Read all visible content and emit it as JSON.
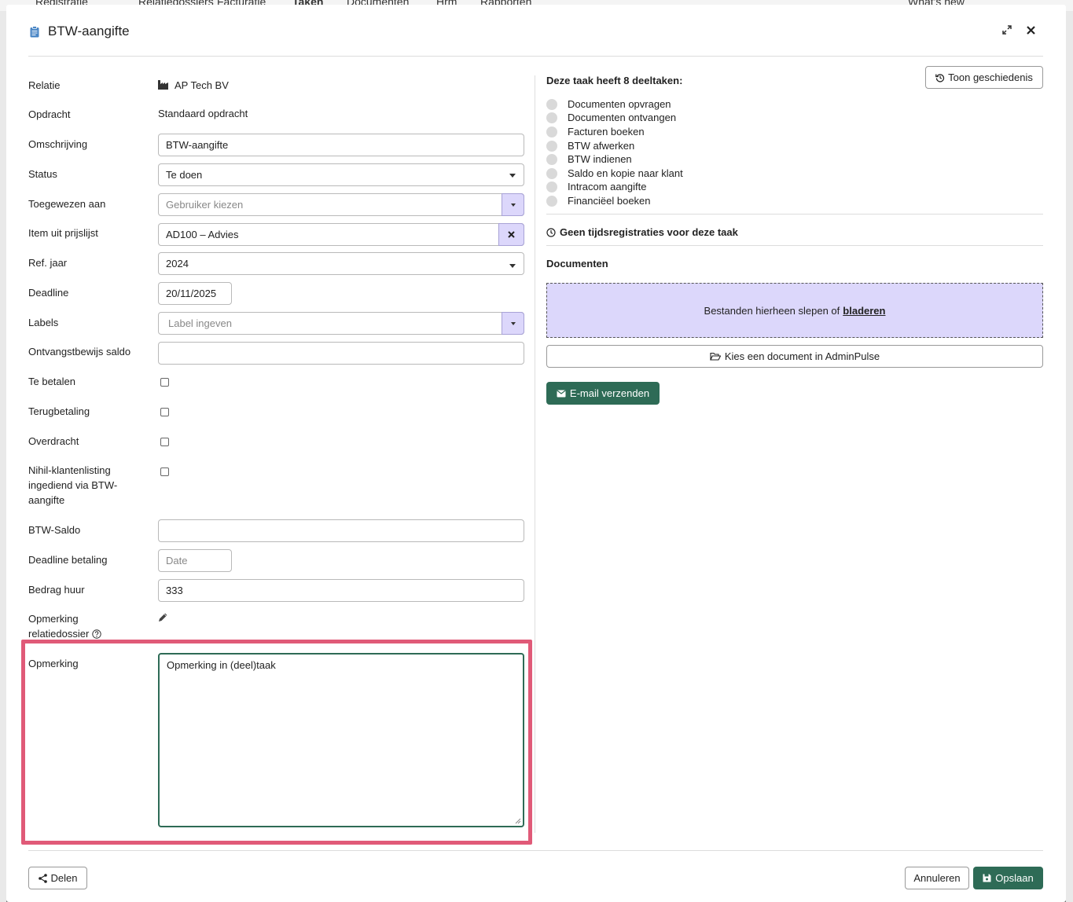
{
  "background_nav": {
    "items": [
      "Registratie",
      "Relatiedossiers",
      "Facturatie",
      "Taken",
      "Documenten",
      "Hrm",
      "Rapporten",
      "What's new"
    ]
  },
  "modal": {
    "title": "BTW-aangifte",
    "title_icon": "clipboard-icon",
    "expand_icon": "expand-icon",
    "close_icon": "close-icon"
  },
  "form": {
    "relatie": {
      "label": "Relatie",
      "value": "AP Tech BV",
      "icon": "factory-icon"
    },
    "opdracht": {
      "label": "Opdracht",
      "value": "Standaard opdracht"
    },
    "omschrijving": {
      "label": "Omschrijving",
      "value": "BTW-aangifte"
    },
    "status": {
      "label": "Status",
      "value": "Te doen"
    },
    "toegewezen": {
      "label": "Toegewezen aan",
      "placeholder": "Gebruiker kiezen"
    },
    "item": {
      "label": "Item uit prijslijst",
      "value": "AD100 – Advies"
    },
    "refjaar": {
      "label": "Ref. jaar",
      "value": "2024"
    },
    "deadline": {
      "label": "Deadline",
      "value": "20/11/2025"
    },
    "labels": {
      "label": "Labels",
      "placeholder": "Label ingeven"
    },
    "ontvangstbewijs": {
      "label": "Ontvangstbewijs saldo",
      "value": ""
    },
    "te_betalen": {
      "label": "Te betalen",
      "checked": false
    },
    "terugbetaling": {
      "label": "Terugbetaling",
      "checked": false
    },
    "overdracht": {
      "label": "Overdracht",
      "checked": false
    },
    "nihil": {
      "label_line1": "Nihil-klantenlisting",
      "label_line2": "ingediend via BTW-",
      "label_line3": "aangifte",
      "checked": false
    },
    "btw_saldo": {
      "label": "BTW-Saldo",
      "value": ""
    },
    "deadline_betaling": {
      "label": "Deadline betaling",
      "placeholder": "Date"
    },
    "bedrag_huur": {
      "label": "Bedrag huur",
      "value": "333"
    },
    "opmerking_relatie": {
      "label_line1": "Opmerking",
      "label_line2": "relatiedossier",
      "edit_icon": "pencil-icon",
      "help_icon": "question-circle-icon"
    },
    "opmerking": {
      "label": "Opmerking",
      "value": "Opmerking in (deel)taak"
    }
  },
  "right": {
    "subtasks_title": "Deze taak heeft 8 deeltaken:",
    "history_button": "Toon geschiedenis",
    "subtasks": [
      "Documenten opvragen",
      "Documenten ontvangen",
      "Facturen boeken",
      "BTW afwerken",
      "BTW indienen",
      "Saldo en kopie naar klant",
      "Intracom aangifte",
      "Financiëel boeken"
    ],
    "time_text": "Geen tijdsregistraties voor deze taak",
    "documents_title": "Documenten",
    "dropzone_text": "Bestanden hierheen slepen of",
    "dropzone_link": "bladeren",
    "pick_button": "Kies een document in AdminPulse",
    "mail_button": "E-mail verzenden"
  },
  "footer": {
    "share_button": "Delen",
    "cancel_button": "Annuleren",
    "save_button": "Opslaan"
  },
  "colors": {
    "primary": "#2e6b56",
    "accent_light": "#dcd7fb",
    "highlight": "#e05a78"
  }
}
